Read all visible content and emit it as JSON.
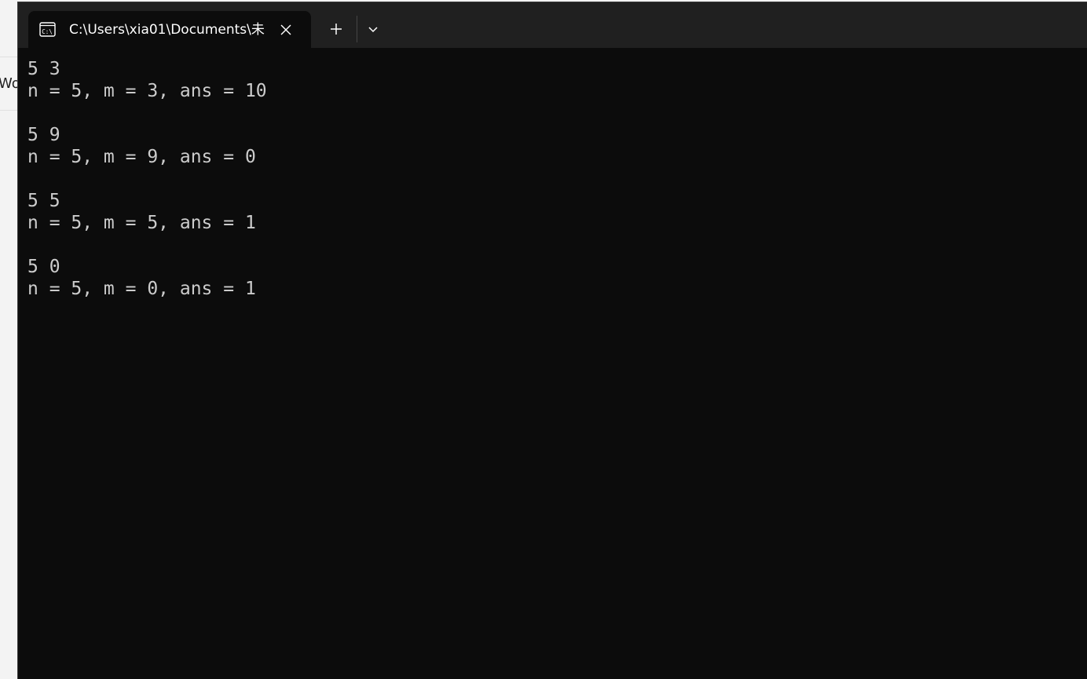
{
  "background_window": {
    "partial_text": "Wo"
  },
  "terminal": {
    "tab": {
      "icon": "console-icon",
      "title": "C:\\Users\\xia01\\Documents\\未",
      "close_icon": "close-icon"
    },
    "new_tab_icon": "plus-icon",
    "dropdown_icon": "chevron-down-icon",
    "output_lines": [
      "5 3",
      "n = 5, m = 3, ans = 10",
      "",
      "5 9",
      "n = 5, m = 9, ans = 0",
      "",
      "5 5",
      "n = 5, m = 5, ans = 1",
      "",
      "5 0",
      "n = 5, m = 0, ans = 1"
    ]
  },
  "colors": {
    "terminal_bg": "#0c0c0c",
    "titlebar_bg": "#202020",
    "text": "#cccccc"
  }
}
